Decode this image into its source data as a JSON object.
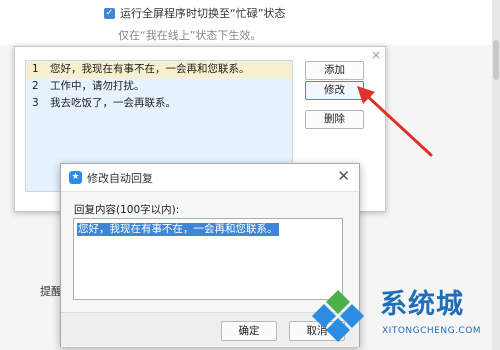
{
  "background": {
    "fullscreen_busy_option": "运行全屏程序时切换至“忙碌”状态",
    "fullscreen_busy_checked": true,
    "online_note": "仅在“我在线上”状态下生效。",
    "left_label": "提醒"
  },
  "list_dialog": {
    "close_symbol": "×",
    "items": [
      {
        "num": "1",
        "text": "您好，我现在有事不在，一会再和您联系。",
        "selected": true
      },
      {
        "num": "2",
        "text": "工作中，请勿打扰。",
        "selected": false
      },
      {
        "num": "3",
        "text": "我去吃饭了，一会再联系。",
        "selected": false
      }
    ],
    "buttons": {
      "add": "添加",
      "modify": "修改",
      "delete": "删除"
    }
  },
  "edit_dialog": {
    "title": "修改自动回复",
    "close_symbol": "✕",
    "prompt": "回复内容(100字以内):",
    "content": "您好，我现在有事不在，一会再和您联系。",
    "ok": "确定",
    "cancel": "取消"
  },
  "watermark": {
    "name": "系统城",
    "domain": "XITONGCHENG.COM"
  },
  "colors": {
    "accent": "#3f86d9",
    "arrow": "#e0312b",
    "watermark": "#1f6fb8"
  }
}
